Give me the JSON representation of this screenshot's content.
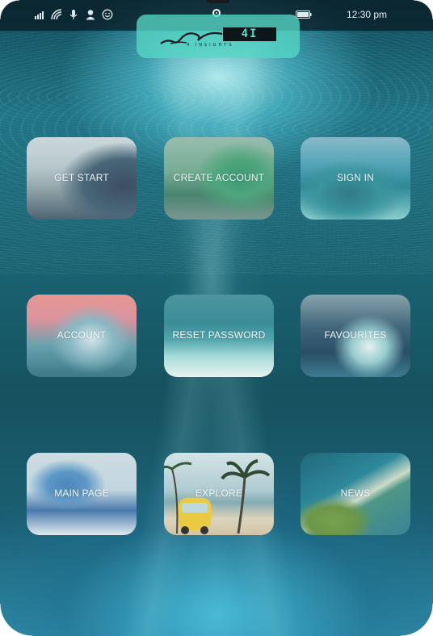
{
  "status_bar": {
    "time": "12:30 pm",
    "icons": [
      "signal-icon",
      "wifi-icon",
      "microphone-icon",
      "person-icon",
      "smiley-icon",
      "camera-dot-icon",
      "battery-icon"
    ]
  },
  "logo": {
    "mark": "4I",
    "subtitle": "4 INSIGHTS"
  },
  "tiles": [
    {
      "label": "GET START"
    },
    {
      "label": "CREATE ACCOUNT"
    },
    {
      "label": "SIGN IN"
    },
    {
      "label": "ACCOUNT"
    },
    {
      "label": "RESET PASSWORD"
    },
    {
      "label": "FAVOURITES"
    },
    {
      "label": "MAIN PAGE"
    },
    {
      "label": "EXPLORE"
    },
    {
      "label": "NEWS"
    }
  ]
}
